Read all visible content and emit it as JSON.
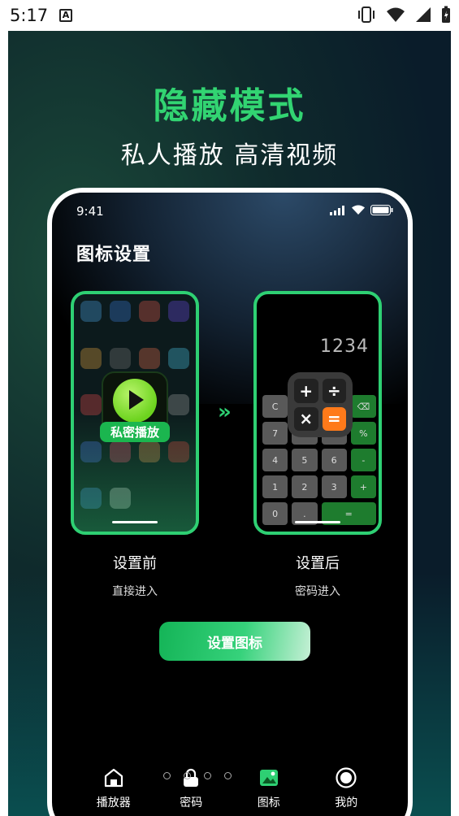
{
  "statusbar": {
    "time": "5:17",
    "a_icon": "A"
  },
  "promo": {
    "title": "隐藏模式",
    "subtitle": "私人播放 高清视频"
  },
  "phone": {
    "time": "9:41",
    "page_title": "图标设置",
    "before": {
      "caption": "设置前",
      "sub": "直接进入",
      "app_label": "私密播放"
    },
    "after": {
      "caption": "设置后",
      "sub": "密码进入",
      "display": "1234",
      "keys": [
        "C",
        "",
        "",
        "⌫",
        "7",
        "",
        "",
        "%",
        "4",
        "5",
        "6",
        "-",
        "1",
        "2",
        "3",
        "+",
        "0",
        ".",
        "="
      ],
      "icon_keys": [
        "+",
        "÷",
        "×",
        "="
      ]
    },
    "arrows": "»",
    "button": "设置图标",
    "nav": [
      {
        "label": "播放器",
        "icon": "house-icon"
      },
      {
        "label": "密码",
        "icon": "lock-icon"
      },
      {
        "label": "图标",
        "icon": "image-icon"
      },
      {
        "label": "我的",
        "icon": "profile-icon"
      }
    ]
  },
  "pager": {
    "count": 4,
    "active": 3
  },
  "colors": {
    "accent": "#2ed073",
    "calc_orange": "#ff7a1a"
  }
}
